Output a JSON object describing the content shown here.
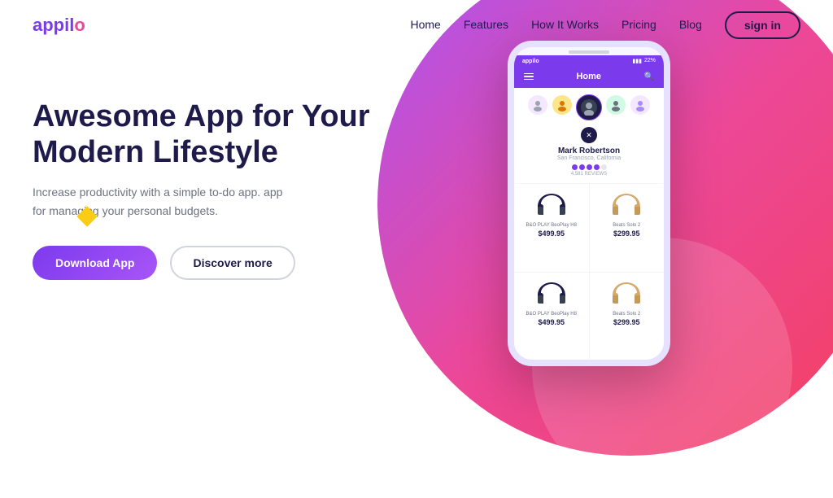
{
  "logo": {
    "text_main": "appil",
    "text_o": "o"
  },
  "nav": {
    "links": [
      {
        "label": "Home",
        "id": "home"
      },
      {
        "label": "Features",
        "id": "features"
      },
      {
        "label": "How It Works",
        "id": "how-it-works"
      },
      {
        "label": "Pricing",
        "id": "pricing"
      },
      {
        "label": "Blog",
        "id": "blog"
      }
    ],
    "signin_label": "sign in"
  },
  "hero": {
    "title_line1": "Awesome App for Your",
    "title_line2": "Modern Lifestyle",
    "description": "Increase productivity with a simple to-do app. app for managing your personal budgets.",
    "btn_download": "Download App",
    "btn_discover": "Discover more"
  },
  "phone": {
    "status_time": "appilo",
    "battery": "22%",
    "app_header_title": "Home",
    "profile_name": "Mark Robertson",
    "profile_location": "San Francisco, California",
    "profile_reviews": "4,581 REVIEWS",
    "products": [
      {
        "name": "B&O PLAY BeoPlay H8",
        "price": "$499.95",
        "type": "headphone-dark"
      },
      {
        "name": "Beats Solo 2",
        "price": "$299.95",
        "type": "headphone-gold"
      },
      {
        "name": "B&O PLAY BeoPlay H8",
        "price": "$499.95",
        "type": "headphone-dark"
      },
      {
        "name": "Beats Solo 2",
        "price": "$299.95",
        "type": "headphone-gold"
      }
    ]
  },
  "colors": {
    "primary": "#7c3aed",
    "secondary": "#ec4899",
    "dark": "#1e1b4b",
    "accent": "#facc15"
  }
}
